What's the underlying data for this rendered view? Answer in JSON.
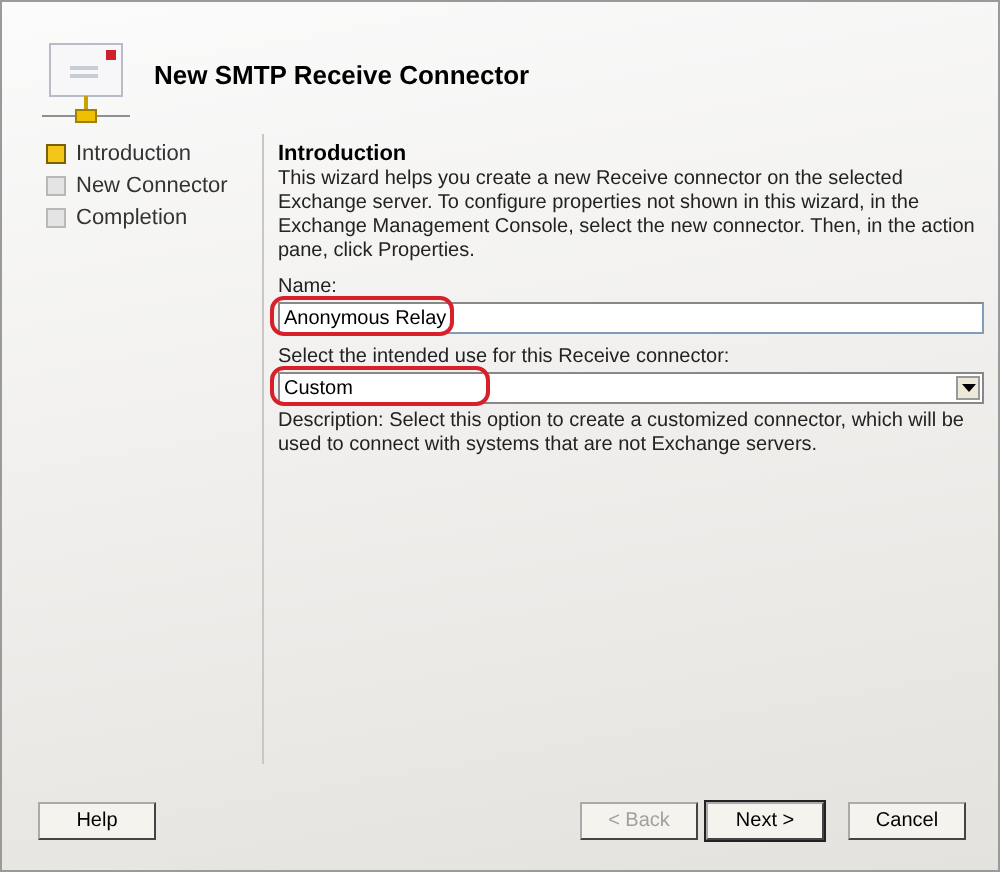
{
  "window": {
    "title": "New SMTP Receive Connector"
  },
  "steps": [
    {
      "label": "Introduction",
      "selected": true
    },
    {
      "label": "New Connector",
      "selected": false
    },
    {
      "label": "Completion",
      "selected": false
    }
  ],
  "page": {
    "heading": "Introduction",
    "text": "This wizard helps you create a new Receive connector on the selected Exchange server. To configure properties not shown in this wizard, in the Exchange Management Console, select the new connector. Then, in the action pane, click Properties.",
    "name_label": "Name:",
    "name_value": "Anonymous Relay",
    "name_highlighted": true,
    "use_label": "Select the intended use for this Receive connector:",
    "use_value": "Custom",
    "use_highlighted": true,
    "description": "Description: Select this option to create a customized connector, which will be used to connect with systems that are not Exchange servers."
  },
  "buttons": [
    {
      "label": "Help",
      "kind": "help",
      "disabled": false,
      "default": false
    },
    {
      "label": "< Back",
      "kind": "nav",
      "disabled": true,
      "default": false
    },
    {
      "label": "Next >",
      "kind": "nav",
      "disabled": false,
      "default": true
    },
    {
      "label": "Cancel",
      "kind": "nav",
      "disabled": false,
      "default": false
    }
  ]
}
